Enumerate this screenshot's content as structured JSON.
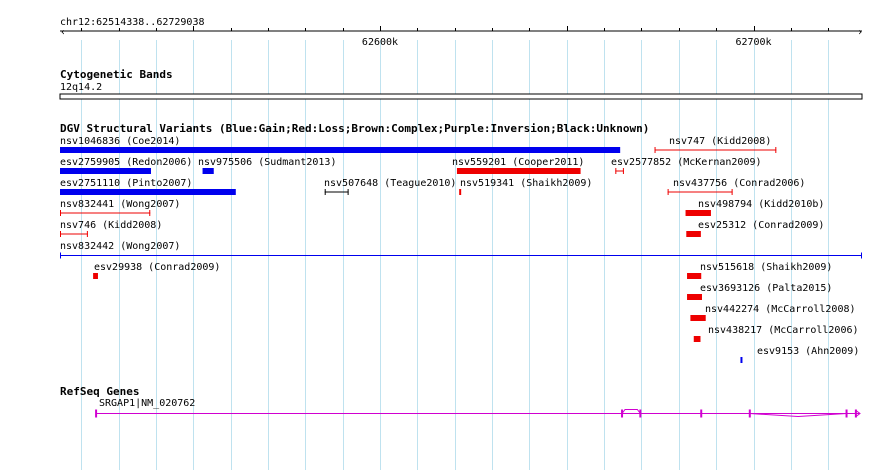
{
  "region": {
    "label": "chr12:62514338..62729038",
    "start": 62514338,
    "end": 62729038
  },
  "ruler": {
    "ticks": [
      {
        "pos": 62600000,
        "label": "62600k"
      },
      {
        "pos": 62700000,
        "label": "62700k"
      }
    ]
  },
  "cytoband": {
    "title": "Cytogenetic Bands",
    "band": "12q14.2"
  },
  "dgv": {
    "title": "DGV Structural Variants (Blue:Gain;Red:Loss;Brown:Complex;Purple:Inversion;Black:Unknown)",
    "colors": {
      "gain": "#0000ee",
      "loss": "#ee0000",
      "unknown": "#000000"
    },
    "upper": [
      {
        "label": "nsv1046836 (Coe2014)",
        "type": "gain",
        "start": 62514338,
        "end": 62664300,
        "style": "bar"
      },
      {
        "label": "nsv747 (Kidd2008)",
        "type": "loss",
        "start": 62673500,
        "end": 62706100,
        "style": "line"
      },
      {
        "label": "esv2759905 (Redon2006)",
        "type": "gain",
        "start": 62514338,
        "end": 62538700,
        "style": "bar"
      },
      {
        "label": "nsv975506 (Sudmant2013)",
        "type": "gain",
        "start": 62552500,
        "end": 62555500,
        "style": "bar"
      },
      {
        "label": "nsv559201 (Cooper2011)",
        "type": "loss",
        "start": 62620600,
        "end": 62653700,
        "style": "bar"
      },
      {
        "label": "esv2577852 (McKernan2009)",
        "type": "loss",
        "start": 62663000,
        "end": 62665300,
        "style": "line"
      },
      {
        "label": "esv2751110 (Pinto2007)",
        "type": "gain",
        "start": 62514338,
        "end": 62561400,
        "style": "bar"
      },
      {
        "label": "nsv507648 (Teague2010)",
        "type": "unknown",
        "start": 62585200,
        "end": 62591600,
        "style": "line"
      },
      {
        "label": "nsv519341 (Shaikh2009)",
        "type": "loss",
        "start": 62621200,
        "end": 62621700,
        "style": "bar"
      },
      {
        "label": "nsv437756 (Conrad2006)",
        "type": "loss",
        "start": 62677000,
        "end": 62694400,
        "style": "line"
      },
      {
        "label": "nsv832441 (Wong2007)",
        "type": "loss",
        "start": 62514338,
        "end": 62538500,
        "style": "line"
      },
      {
        "label": "nsv498794 (Kidd2010b)",
        "type": "loss",
        "start": 62681800,
        "end": 62688600,
        "style": "bar"
      },
      {
        "label": "nsv746 (Kidd2008)",
        "type": "loss",
        "start": 62514338,
        "end": 62521800,
        "style": "line"
      },
      {
        "label": "esv25312 (Conrad2009)",
        "type": "loss",
        "start": 62682000,
        "end": 62685900,
        "style": "bar"
      }
    ],
    "long_line": {
      "label": "nsv832442 (Wong2007)",
      "type": "gain",
      "start": 62514338,
      "end": 62729038
    },
    "lower": [
      {
        "label": "esv29938 (Conrad2009)",
        "type": "loss",
        "start": 62523200,
        "end": 62524500
      },
      {
        "label": "nsv515618 (Shaikh2009)",
        "type": "loss",
        "start": 62682200,
        "end": 62686000
      },
      {
        "label": "esv3693126 (Palta2015)",
        "type": "loss",
        "start": 62682200,
        "end": 62686200
      },
      {
        "label": "nsv442274 (McCarroll2008)",
        "type": "loss",
        "start": 62683100,
        "end": 62687200
      },
      {
        "label": "nsv438217 (McCarroll2006)",
        "type": "loss",
        "start": 62684000,
        "end": 62685800
      },
      {
        "label": "esv9153 (Ahn2009)",
        "type": "gain",
        "start": 62696500,
        "end": 62696900
      }
    ]
  },
  "refseq": {
    "title": "RefSeq Genes",
    "color": "#d000d0",
    "gene": {
      "label": "SRGAP1|NM_020762",
      "start": 62524000,
      "end": 62729038,
      "strand": "+",
      "exons": [
        62524000,
        62664800,
        62669700,
        62686000,
        62699000,
        62724900,
        62727400
      ]
    }
  }
}
